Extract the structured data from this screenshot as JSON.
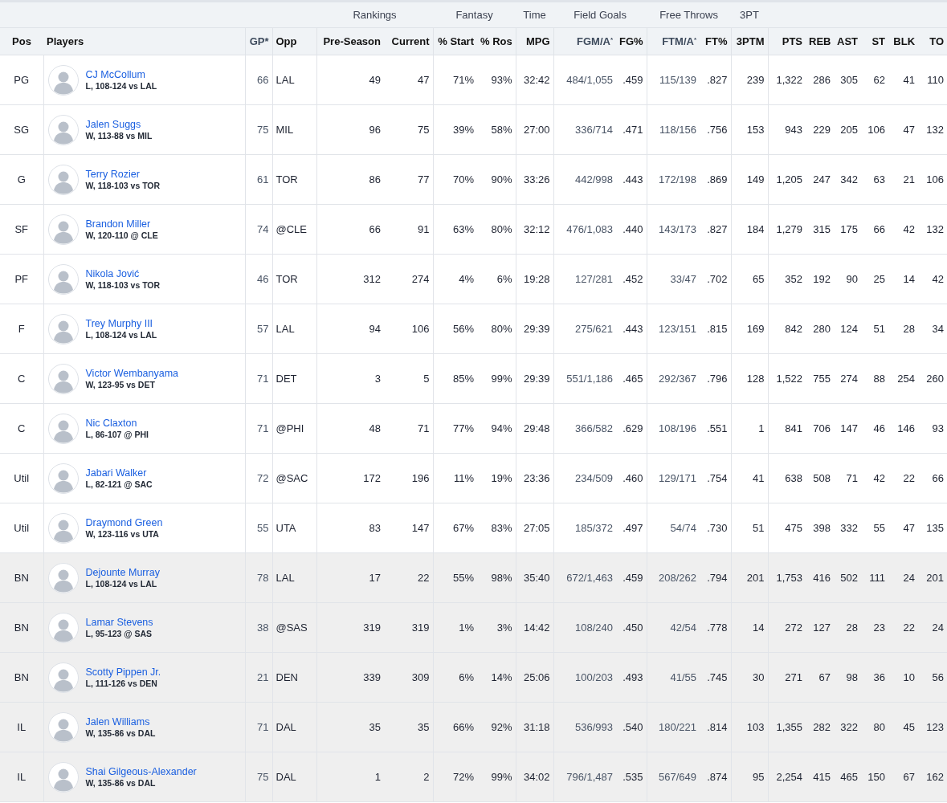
{
  "column_groups": [
    {
      "columns": [
        "Pos",
        "Players",
        "GP*",
        "Opp"
      ]
    },
    {
      "label": "Rankings",
      "columns": [
        "Pre-Season",
        "Current"
      ]
    },
    {
      "label": "Fantasy",
      "columns": [
        "% Start",
        "% Ros"
      ]
    },
    {
      "label": "Time",
      "columns": [
        "MPG"
      ]
    },
    {
      "label": "Field Goals",
      "columns": [
        "FGM/A$^{*}$",
        "FG%"
      ]
    },
    {
      "label": "Free Throws",
      "columns": [
        "FTM/A$^{*}$",
        "FT%"
      ]
    },
    {
      "label": "3PT",
      "columns": [
        "3PTM"
      ]
    },
    {
      "columns": [
        "PTS",
        "REB",
        "AST",
        "ST",
        "BLK",
        "TO"
      ]
    }
  ],
  "rows": [
    {
      "pos": "PG",
      "reserve": false,
      "name": "CJ McCollum",
      "result": "L, 108-124 vs LAL",
      "stats": [
        "66",
        "LAL",
        "49",
        "47",
        "71%",
        "93%",
        "32:42",
        "484/1,055",
        ".459",
        "115/139",
        ".827",
        "239",
        "1,322",
        "286",
        "305",
        "62",
        "41",
        "110"
      ]
    },
    {
      "pos": "SG",
      "reserve": false,
      "name": "Jalen Suggs",
      "result": "W, 113-88 vs MIL",
      "stats": [
        "75",
        "MIL",
        "96",
        "75",
        "39%",
        "58%",
        "27:00",
        "336/714",
        ".471",
        "118/156",
        ".756",
        "153",
        "943",
        "229",
        "205",
        "106",
        "47",
        "132"
      ]
    },
    {
      "pos": "G",
      "reserve": false,
      "name": "Terry Rozier",
      "result": "W, 118-103 vs TOR",
      "stats": [
        "61",
        "TOR",
        "86",
        "77",
        "70%",
        "90%",
        "33:26",
        "442/998",
        ".443",
        "172/198",
        ".869",
        "149",
        "1,205",
        "247",
        "342",
        "63",
        "21",
        "106"
      ]
    },
    {
      "pos": "SF",
      "reserve": false,
      "name": "Brandon Miller",
      "result": "W, 120-110 @ CLE",
      "stats": [
        "74",
        "@CLE",
        "66",
        "91",
        "63%",
        "80%",
        "32:12",
        "476/1,083",
        ".440",
        "143/173",
        ".827",
        "184",
        "1,279",
        "315",
        "175",
        "66",
        "42",
        "132"
      ]
    },
    {
      "pos": "PF",
      "reserve": false,
      "name": "Nikola Jović",
      "result": "W, 118-103 vs TOR",
      "stats": [
        "46",
        "TOR",
        "312",
        "274",
        "4%",
        "6%",
        "19:28",
        "127/281",
        ".452",
        "33/47",
        ".702",
        "65",
        "352",
        "192",
        "90",
        "25",
        "14",
        "42"
      ]
    },
    {
      "pos": "F",
      "reserve": false,
      "name": "Trey Murphy III",
      "result": "L, 108-124 vs LAL",
      "stats": [
        "57",
        "LAL",
        "94",
        "106",
        "56%",
        "80%",
        "29:39",
        "275/621",
        ".443",
        "123/151",
        ".815",
        "169",
        "842",
        "280",
        "124",
        "51",
        "28",
        "34"
      ]
    },
    {
      "pos": "C",
      "reserve": false,
      "name": "Victor Wembanyama",
      "result": "W, 123-95 vs DET",
      "stats": [
        "71",
        "DET",
        "3",
        "5",
        "85%",
        "99%",
        "29:39",
        "551/1,186",
        ".465",
        "292/367",
        ".796",
        "128",
        "1,522",
        "755",
        "274",
        "88",
        "254",
        "260"
      ]
    },
    {
      "pos": "C",
      "reserve": false,
      "name": "Nic Claxton",
      "result": "L, 86-107 @ PHI",
      "stats": [
        "71",
        "@PHI",
        "48",
        "71",
        "77%",
        "94%",
        "29:48",
        "366/582",
        ".629",
        "108/196",
        ".551",
        "1",
        "841",
        "706",
        "147",
        "46",
        "146",
        "93"
      ]
    },
    {
      "pos": "Util",
      "reserve": false,
      "name": "Jabari Walker",
      "result": "L, 82-121 @ SAC",
      "stats": [
        "72",
        "@SAC",
        "172",
        "196",
        "11%",
        "19%",
        "23:36",
        "234/509",
        ".460",
        "129/171",
        ".754",
        "41",
        "638",
        "508",
        "71",
        "42",
        "22",
        "66"
      ]
    },
    {
      "pos": "Util",
      "reserve": false,
      "name": "Draymond Green",
      "result": "W, 123-116 vs UTA",
      "stats": [
        "55",
        "UTA",
        "83",
        "147",
        "67%",
        "83%",
        "27:05",
        "185/372",
        ".497",
        "54/74",
        ".730",
        "51",
        "475",
        "398",
        "332",
        "55",
        "47",
        "135"
      ]
    },
    {
      "pos": "BN",
      "reserve": true,
      "name": "Dejounte Murray",
      "result": "L, 108-124 vs LAL",
      "stats": [
        "78",
        "LAL",
        "17",
        "22",
        "55%",
        "98%",
        "35:40",
        "672/1,463",
        ".459",
        "208/262",
        ".794",
        "201",
        "1,753",
        "416",
        "502",
        "111",
        "24",
        "201"
      ]
    },
    {
      "pos": "BN",
      "reserve": true,
      "name": "Lamar Stevens",
      "result": "L, 95-123 @ SAS",
      "stats": [
        "38",
        "@SAS",
        "319",
        "319",
        "1%",
        "3%",
        "14:42",
        "108/240",
        ".450",
        "42/54",
        ".778",
        "14",
        "272",
        "127",
        "28",
        "23",
        "22",
        "24"
      ]
    },
    {
      "pos": "BN",
      "reserve": true,
      "name": "Scotty Pippen Jr.",
      "result": "L, 111-126 vs DEN",
      "stats": [
        "21",
        "DEN",
        "339",
        "309",
        "6%",
        "14%",
        "25:06",
        "100/203",
        ".493",
        "41/55",
        ".745",
        "30",
        "271",
        "67",
        "98",
        "36",
        "10",
        "56"
      ]
    },
    {
      "pos": "IL",
      "reserve": true,
      "name": "Jalen Williams",
      "result": "W, 135-86 vs DAL",
      "stats": [
        "71",
        "DAL",
        "35",
        "35",
        "66%",
        "92%",
        "31:18",
        "536/993",
        ".540",
        "180/221",
        ".814",
        "103",
        "1,355",
        "282",
        "322",
        "80",
        "45",
        "123"
      ]
    },
    {
      "pos": "IL",
      "reserve": true,
      "name": "Shai Gilgeous-Alexander",
      "result": "W, 135-86 vs DAL",
      "stats": [
        "75",
        "DAL",
        "1",
        "2",
        "72%",
        "99%",
        "34:02",
        "796/1,487",
        ".535",
        "567/649",
        ".874",
        "95",
        "2,254",
        "415",
        "465",
        "150",
        "67",
        "162"
      ]
    }
  ]
}
